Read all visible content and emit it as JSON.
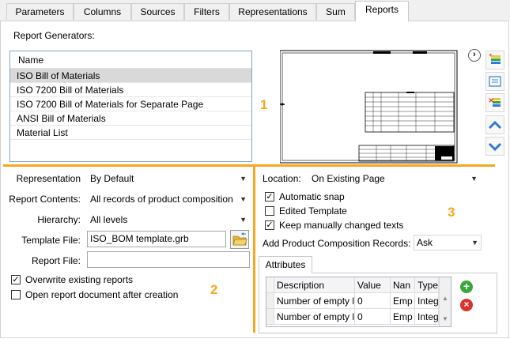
{
  "tabs": [
    "Parameters",
    "Columns",
    "Sources",
    "Filters",
    "Representations",
    "Sum",
    "Reports"
  ],
  "active_tab": "Reports",
  "report_generators": {
    "label": "Report Generators:",
    "column_header": "Name",
    "items": [
      "ISO Bill of Materials",
      "ISO 7200 Bill of Materials",
      "ISO 7200 Bill of Materials for Separate Page",
      "ANSI Bill of Materials",
      "Material List"
    ],
    "selected_index": 0
  },
  "markers": {
    "one": "1",
    "two": "2",
    "three": "3"
  },
  "form": {
    "representation_label": "Representation",
    "representation_value": "By Default",
    "report_contents_label": "Report Contents:",
    "report_contents_value": "All records of product composition",
    "hierarchy_label": "Hierarchy:",
    "hierarchy_value": "All levels",
    "template_file_label": "Template File:",
    "template_file_value": "ISO_BOM template.grb",
    "report_file_label": "Report File:",
    "report_file_value": "",
    "overwrite_label": "Overwrite existing reports",
    "overwrite_checked": true,
    "open_after_label": "Open report document after creation",
    "open_after_checked": false
  },
  "right": {
    "location_label": "Location:",
    "location_value": "On Existing Page",
    "automatic_snap_label": "Automatic snap",
    "automatic_snap_checked": true,
    "edited_template_label": "Edited Template",
    "edited_template_checked": false,
    "keep_texts_label": "Keep manually changed texts",
    "keep_texts_checked": true,
    "add_records_label": "Add Product Composition Records:",
    "add_records_value": "Ask"
  },
  "attributes": {
    "tab_label": "Attributes",
    "columns": [
      "Description",
      "Value",
      "Nan",
      "Type"
    ],
    "rows": [
      [
        "Number of empty l",
        "0",
        "Emp",
        "Integ"
      ],
      [
        "Number of empty l",
        "0",
        "Emp",
        "Integ"
      ]
    ]
  },
  "colors": {
    "accent": "#f6a81e",
    "selection": "#d9d9d9",
    "add": "#3aa63a",
    "delete": "#d9342b",
    "nav_blue": "#2f7bd6"
  }
}
